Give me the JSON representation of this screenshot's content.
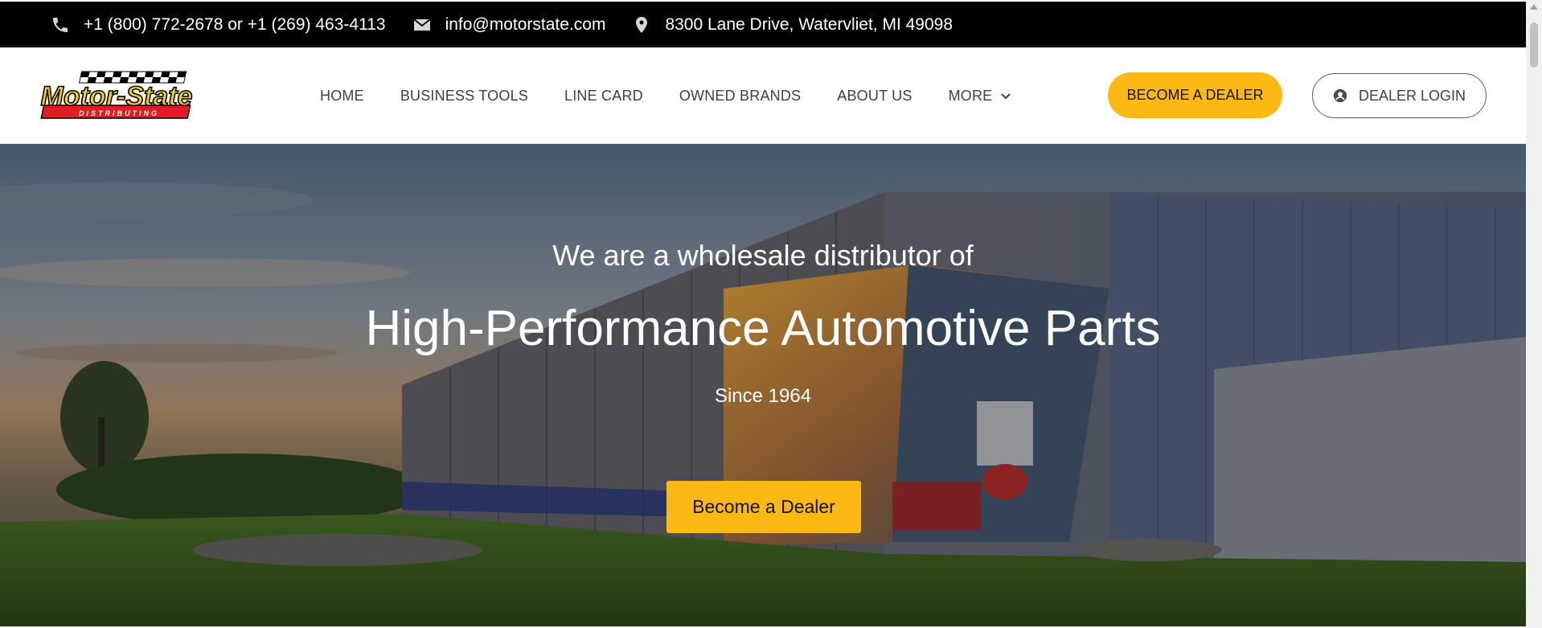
{
  "topbar": {
    "phone": "+1 (800) 772-2678 or +1 (269) 463-4113",
    "email": "info@motorstate.com",
    "address": "8300 Lane Drive, Watervliet, MI 49098"
  },
  "logo": {
    "text": "Motor-State",
    "subtext": "DISTRIBUTING"
  },
  "nav": {
    "items": [
      {
        "label": "HOME"
      },
      {
        "label": "BUSINESS TOOLS"
      },
      {
        "label": "LINE CARD"
      },
      {
        "label": "OWNED BRANDS"
      },
      {
        "label": "ABOUT US"
      },
      {
        "label": "MORE"
      }
    ]
  },
  "header": {
    "become_dealer_label": "BECOME A DEALER",
    "dealer_login_label": "DEALER LOGIN"
  },
  "hero": {
    "subtitle": "We are a wholesale distributor of",
    "title": "High-Performance Automotive Parts",
    "since": "Since 1964",
    "cta_label": "Become a Dealer"
  },
  "colors": {
    "accent": "#fdb913",
    "topbar_bg": "#000000",
    "nav_text": "#3f3f3f"
  },
  "icons": {
    "phone": "phone-icon",
    "email": "envelope-icon",
    "address": "map-marker-icon",
    "more": "chevron-down-icon",
    "login": "user-circle-icon"
  }
}
